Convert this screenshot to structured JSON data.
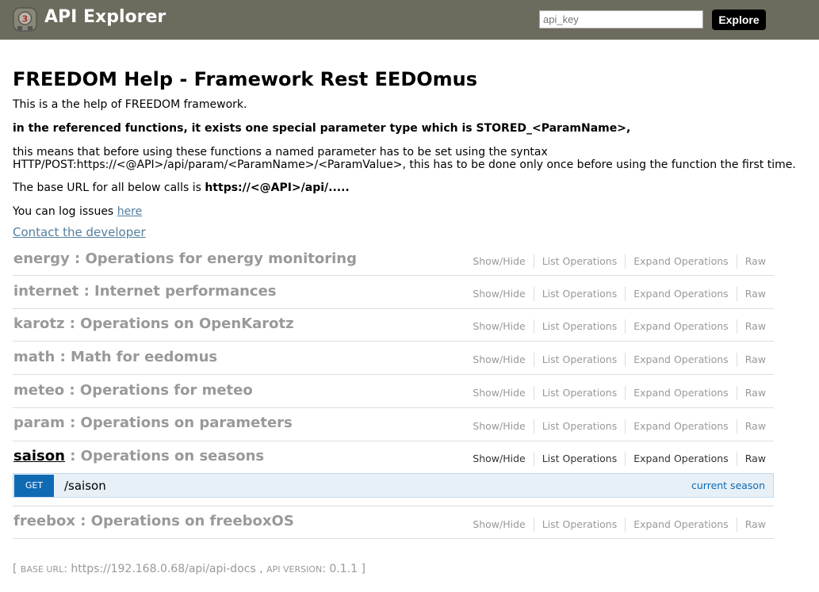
{
  "header": {
    "title": "API Explorer",
    "api_key_placeholder": "api_key",
    "explore_label": "Explore",
    "colors": {
      "bar": "#6d6b5d",
      "button": "#000000"
    }
  },
  "info": {
    "title": "FREEDOM Help - Framework Rest EEDOmus",
    "line1": "This is a the help of FREEDOM framework.",
    "line2": "in the referenced functions, it exists one special parameter type which is STORED_<ParamName>,",
    "line3a": "this means that before using these functions a named parameter has to be set using the syntax",
    "line3b": "HTTP/POST:https://<@API>/api/param/<ParamName>/<ParamValue>, this has to be done only once before using the function the first time.",
    "line4_prefix": "The base URL for all below calls is ",
    "line4_url": "https://<@API>/api/.....",
    "line5_prefix": "You can log issues ",
    "line5_link": "here",
    "contact": "Contact the developer"
  },
  "operations_labels": {
    "show_hide": "Show/Hide",
    "list": "List Operations",
    "expand": "Expand Operations",
    "raw": "Raw"
  },
  "resources": [
    {
      "name": "energy",
      "desc": " : Operations for energy monitoring"
    },
    {
      "name": "internet",
      "desc": " : Internet performances"
    },
    {
      "name": "karotz",
      "desc": " : Operations on OpenKarotz"
    },
    {
      "name": "math",
      "desc": " : Math for eedomus"
    },
    {
      "name": "meteo",
      "desc": " : Operations for meteo"
    },
    {
      "name": "param",
      "desc": " : Operations on parameters"
    },
    {
      "name": "saison",
      "desc": " : Operations on seasons"
    },
    {
      "name": "freebox",
      "desc": " : Operations on freeboxOS"
    }
  ],
  "endpoint": {
    "method": "GET",
    "path": "/saison",
    "summary": "current season",
    "colors": {
      "badge": "#0f6ab4",
      "background": "#e7f0f7"
    }
  },
  "footer": {
    "open": "[ ",
    "base_url_label": "base url",
    "base_url": ": https://192.168.0.68/api/api-docs , ",
    "api_version_label": "api version",
    "api_version": ": 0.1.1 ]"
  }
}
